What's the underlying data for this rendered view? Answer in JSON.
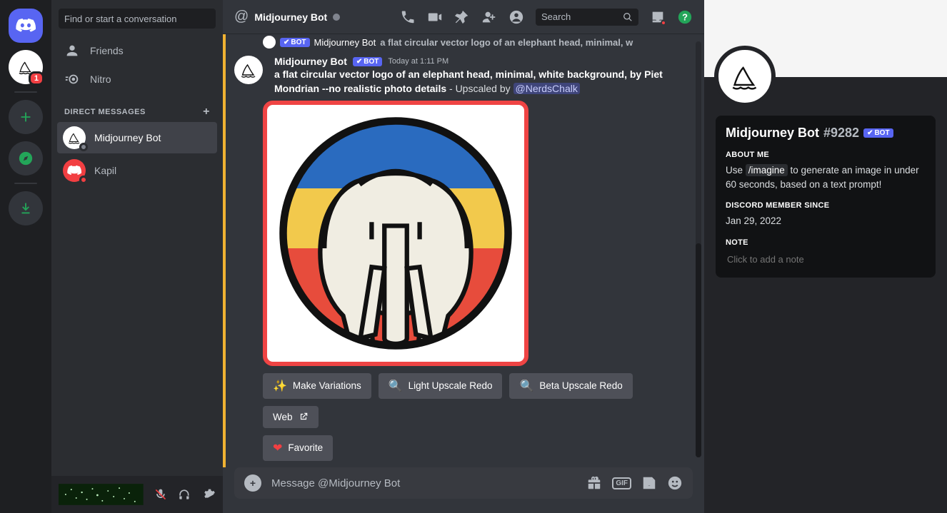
{
  "rail": {
    "home_badge": "1"
  },
  "sidebar": {
    "search_placeholder": "Find or start a conversation",
    "nav": {
      "friends": "Friends",
      "nitro": "Nitro"
    },
    "dm_header": "DIRECT MESSAGES",
    "dms": [
      {
        "name": "Midjourney Bot"
      },
      {
        "name": "Kapil"
      }
    ]
  },
  "header": {
    "title": "Midjourney Bot",
    "search_placeholder": "Search"
  },
  "chat": {
    "prev": {
      "user": "Midjourney Bot",
      "text": "a flat circular vector logo of an elephant head, minimal, w"
    },
    "msg": {
      "user": "Midjourney Bot",
      "timestamp": "Today at 1:11 PM",
      "bot_badge": "BOT",
      "prompt": "a flat circular vector logo of an elephant head, minimal, white background, by Piet Mondrian --no realistic photo details",
      "upscaled_prefix": " - Upscaled by ",
      "mention": "@NerdsChalk"
    },
    "buttons": {
      "variations": "Make Variations",
      "light": "Light Upscale Redo",
      "beta": "Beta Upscale Redo",
      "web": "Web",
      "fav": "Favorite"
    }
  },
  "composer": {
    "placeholder": "Message @Midjourney Bot",
    "gif_label": "GIF"
  },
  "profile": {
    "name": "Midjourney Bot",
    "disc": "#9282",
    "bot_badge": "BOT",
    "about_header": "ABOUT ME",
    "about_pre": "Use ",
    "about_cmd": "/imagine",
    "about_post": " to generate an image in under 60 seconds, based on a text prompt!",
    "member_header": "DISCORD MEMBER SINCE",
    "member_since": "Jan 29, 2022",
    "note_header": "NOTE",
    "note_placeholder": "Click to add a note"
  }
}
